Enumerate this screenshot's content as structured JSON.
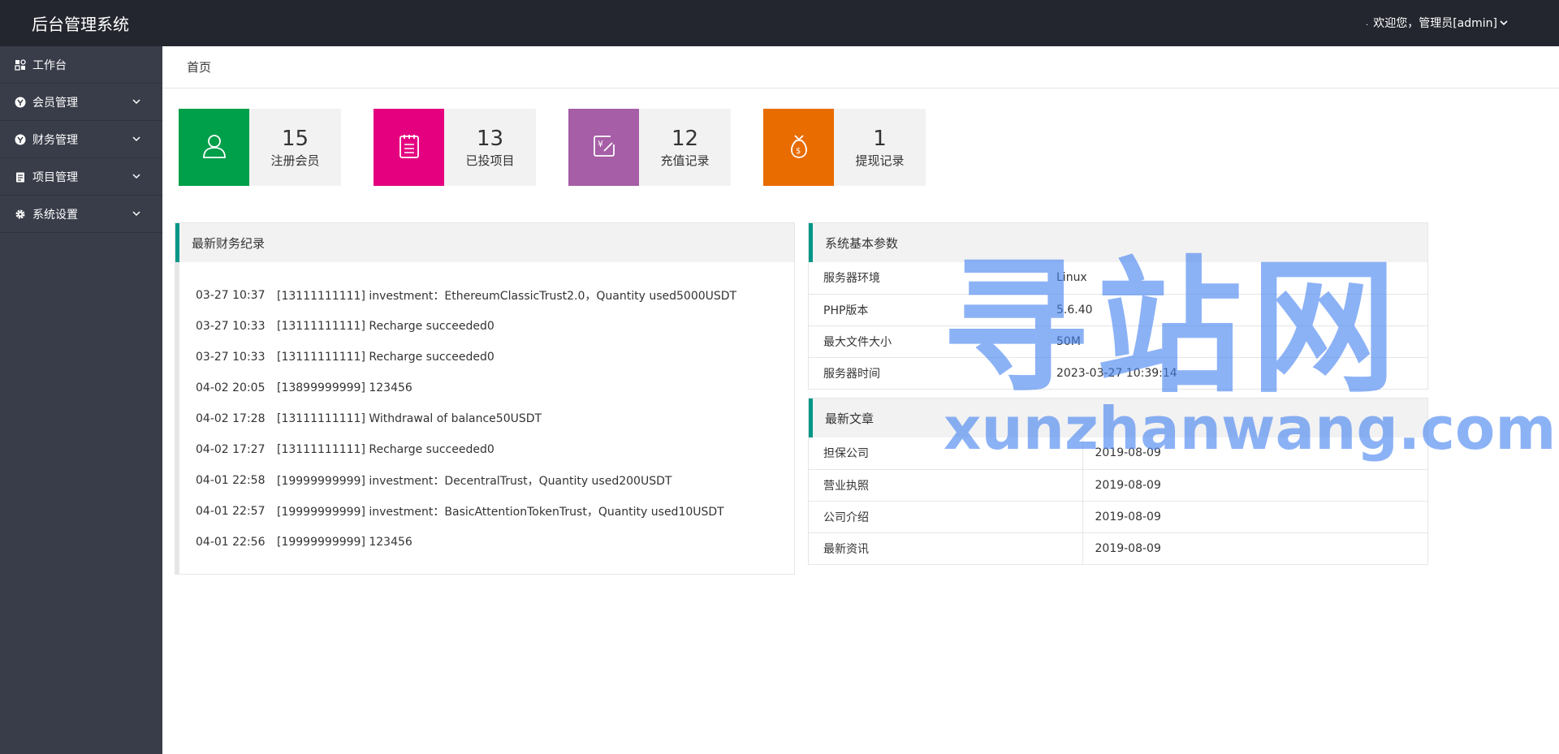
{
  "header": {
    "title": "后台管理系统",
    "welcome": "欢迎您，管理员[admin]"
  },
  "sidebar": {
    "items": [
      {
        "label": "工作台",
        "icon": "dashboard-icon"
      },
      {
        "label": "会员管理",
        "icon": "member-icon"
      },
      {
        "label": "财务管理",
        "icon": "finance-icon"
      },
      {
        "label": "项目管理",
        "icon": "project-icon"
      },
      {
        "label": "系统设置",
        "icon": "gear-icon"
      }
    ]
  },
  "breadcrumb": "首页",
  "stats": [
    {
      "value": "15",
      "label": "注册会员",
      "color": "#009f4a",
      "icon": "user-icon"
    },
    {
      "value": "13",
      "label": "已投项目",
      "color": "#e4007f",
      "icon": "notepad-icon"
    },
    {
      "value": "12",
      "label": "充值记录",
      "color": "#a65ea6",
      "icon": "recharge-icon"
    },
    {
      "value": "1",
      "label": "提现记录",
      "color": "#e86c00",
      "icon": "money-bag-icon"
    }
  ],
  "finance": {
    "title": "最新财务纪录",
    "rows": [
      {
        "time": "03-27 10:37",
        "text": "[13111111111] investment：EthereumClassicTrust2.0，Quantity used5000USDT"
      },
      {
        "time": "03-27 10:33",
        "text": "[13111111111] Recharge succeeded0"
      },
      {
        "time": "03-27 10:33",
        "text": "[13111111111] Recharge succeeded0"
      },
      {
        "time": "04-02 20:05",
        "text": "[13899999999] 123456"
      },
      {
        "time": "04-02 17:28",
        "text": "[13111111111] Withdrawal of balance50USDT"
      },
      {
        "time": "04-02 17:27",
        "text": "[13111111111] Recharge succeeded0"
      },
      {
        "time": "04-01 22:58",
        "text": "[19999999999] investment：DecentralTrust，Quantity used200USDT"
      },
      {
        "time": "04-01 22:57",
        "text": "[19999999999] investment：BasicAttentionTokenTrust，Quantity used10USDT"
      },
      {
        "time": "04-01 22:56",
        "text": "[19999999999] 123456"
      }
    ]
  },
  "system": {
    "title": "系统基本参数",
    "rows": [
      {
        "key": "服务器环境",
        "value": "Linux"
      },
      {
        "key": "PHP版本",
        "value": "5.6.40"
      },
      {
        "key": "最大文件大小",
        "value": "50M"
      },
      {
        "key": "服务器时间",
        "value": "2023-03-27 10:39:14"
      }
    ]
  },
  "articles": {
    "title": "最新文章",
    "rows": [
      {
        "key": "担保公司",
        "value": "2019-08-09"
      },
      {
        "key": "营业执照",
        "value": "2019-08-09"
      },
      {
        "key": "公司介绍",
        "value": "2019-08-09"
      },
      {
        "key": "最新资讯",
        "value": "2019-08-09"
      }
    ]
  },
  "watermark": {
    "cn": "寻站网",
    "en": "xunzhanwang.com"
  },
  "colors": {
    "topbar": "#23262e",
    "sidebar": "#393d49",
    "accent": "#009688"
  }
}
